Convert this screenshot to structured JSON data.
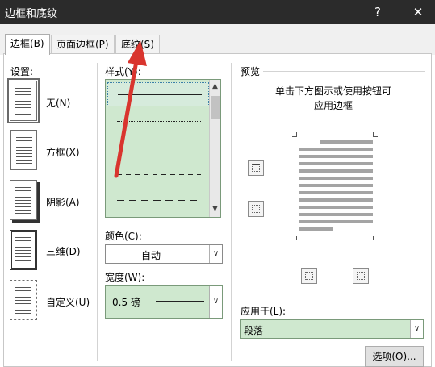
{
  "window": {
    "title": "边框和底纹",
    "help": "?",
    "close": "✕"
  },
  "tabs": [
    {
      "label": "边框(B)"
    },
    {
      "label": "页面边框(P)"
    },
    {
      "label": "底纹(S)"
    }
  ],
  "settings": {
    "heading": "设置:",
    "presets": [
      {
        "label": "无(N)",
        "icon": "border-none-icon"
      },
      {
        "label": "方框(X)",
        "icon": "border-box-icon"
      },
      {
        "label": "阴影(A)",
        "icon": "border-shadow-icon"
      },
      {
        "label": "三维(D)",
        "icon": "border-3d-icon"
      },
      {
        "label": "自定义(U)",
        "icon": "border-custom-icon"
      }
    ]
  },
  "style": {
    "heading": "样式(Y):",
    "items": [
      "solid",
      "dotted",
      "dashed-small",
      "dashed",
      "dash-dot"
    ]
  },
  "color": {
    "heading": "颜色(C):",
    "value": "自动"
  },
  "width": {
    "heading": "宽度(W):",
    "value": "0.5 磅"
  },
  "preview": {
    "heading": "预览",
    "hint": "单击下方图示或使用按钮可\n应用边框"
  },
  "apply_to": {
    "heading": "应用于(L):",
    "value": "段落"
  },
  "options_button": "选项(O)...",
  "colors": {
    "titlebar": "#2b2b2b",
    "selection_green": "#cfe8cf",
    "arrow_red": "#d9352e"
  }
}
